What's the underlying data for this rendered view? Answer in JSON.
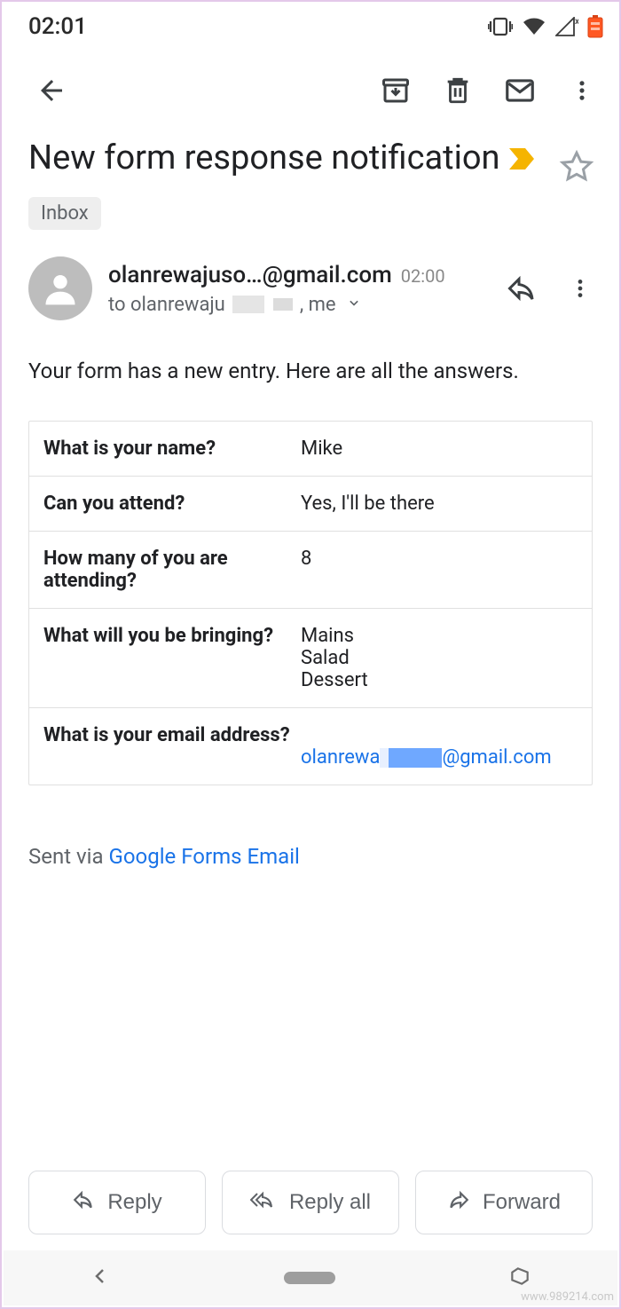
{
  "status_bar": {
    "time": "02:01"
  },
  "email": {
    "subject": "New form response notification",
    "label": "Inbox",
    "sender": {
      "from_display": "olanrewajuso…@gmail.com",
      "time": "02:00",
      "to_prefix": "to olanrewaju",
      "to_suffix": ", me"
    },
    "body_intro": "Your form has a new entry. Here are all the answers.",
    "answers": [
      {
        "question": "What is your name?",
        "value": "Mike"
      },
      {
        "question": "Can you attend?",
        "value": "Yes, I'll be there"
      },
      {
        "question": "How many of you are attending?",
        "value": "8"
      },
      {
        "question": "What will you be bringing?",
        "value": "Mains\nSalad\nDessert"
      },
      {
        "question": "What is your email address?",
        "value_prefix": "olanrewa",
        "value_suffix": "@gmail.com",
        "is_link": true
      }
    ],
    "sent_via_prefix": "Sent via ",
    "sent_via_link": "Google Forms Email"
  },
  "actions": {
    "reply": "Reply",
    "reply_all": "Reply all",
    "forward": "Forward"
  },
  "watermark": "www.989214.com"
}
